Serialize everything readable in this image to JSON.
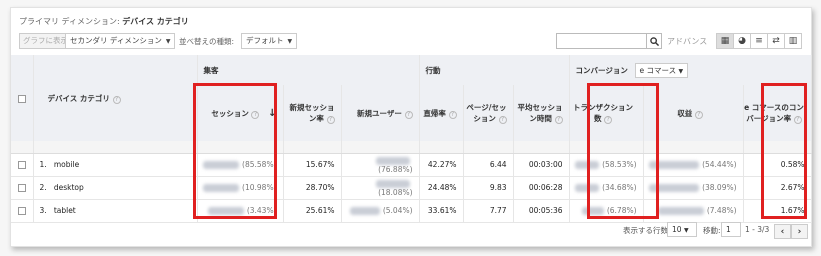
{
  "primary_dimension": {
    "label": "プライマリ ディメンション:",
    "value": "デバイス カテゴリ"
  },
  "toolbar": {
    "plot_rows": "グラフに表示",
    "secondary_dimension": "セカンダリ ディメンション",
    "sort_label": "並べ替えの種類:",
    "sort_value": "デフォルト",
    "search_placeholder": "",
    "advanced": "アドバンス"
  },
  "table": {
    "groups": {
      "acquisition": "集客",
      "behavior": "行動",
      "conversions": "コンバージョン",
      "conversion_select": "e コマース"
    },
    "columns": {
      "device": "デバイス カテゴリ",
      "sessions": "セッション",
      "new_sessions_rate": "新規セッション率",
      "new_users": "新規ユーザー",
      "bounce_rate": "直帰率",
      "pages_per_session": "ページ/セッション",
      "avg_session_duration": "平均セッション時間",
      "transactions": "トランザクション数",
      "revenue": "収益",
      "ecommerce_conversion_rate": "e コマースのコンバージョン率"
    },
    "rows": [
      {
        "num": "1.",
        "device": "mobile",
        "sessions_pct": "(85.58%)",
        "new_sessions_rate": "15.67%",
        "new_users_pct": "(76.88%)",
        "bounce_rate": "42.27%",
        "pages_per_session": "6.44",
        "avg_duration": "00:03:00",
        "transactions_pct": "(58.53%)",
        "revenue_pct": "(54.44%)",
        "conv_rate": "0.58%"
      },
      {
        "num": "2.",
        "device": "desktop",
        "sessions_pct": "(10.98%)",
        "new_sessions_rate": "28.70%",
        "new_users_pct": "(18.08%)",
        "bounce_rate": "24.48%",
        "pages_per_session": "9.83",
        "avg_duration": "00:06:28",
        "transactions_pct": "(34.68%)",
        "revenue_pct": "(38.09%)",
        "conv_rate": "2.67%"
      },
      {
        "num": "3.",
        "device": "tablet",
        "sessions_pct": "(3.43%)",
        "new_sessions_rate": "25.61%",
        "new_users_pct": "(5.04%)",
        "bounce_rate": "33.61%",
        "pages_per_session": "7.77",
        "avg_duration": "00:05:36",
        "transactions_pct": "(6.78%)",
        "revenue_pct": "(7.48%)",
        "conv_rate": "1.67%"
      }
    ]
  },
  "pagination": {
    "rows_label": "表示する行数:",
    "rows_value": "10",
    "goto_label": "移動:",
    "goto_value": "1",
    "range": "1 - 3/3"
  },
  "colors": {
    "highlight": "#e02020",
    "header_bg": "#eef0f4"
  }
}
